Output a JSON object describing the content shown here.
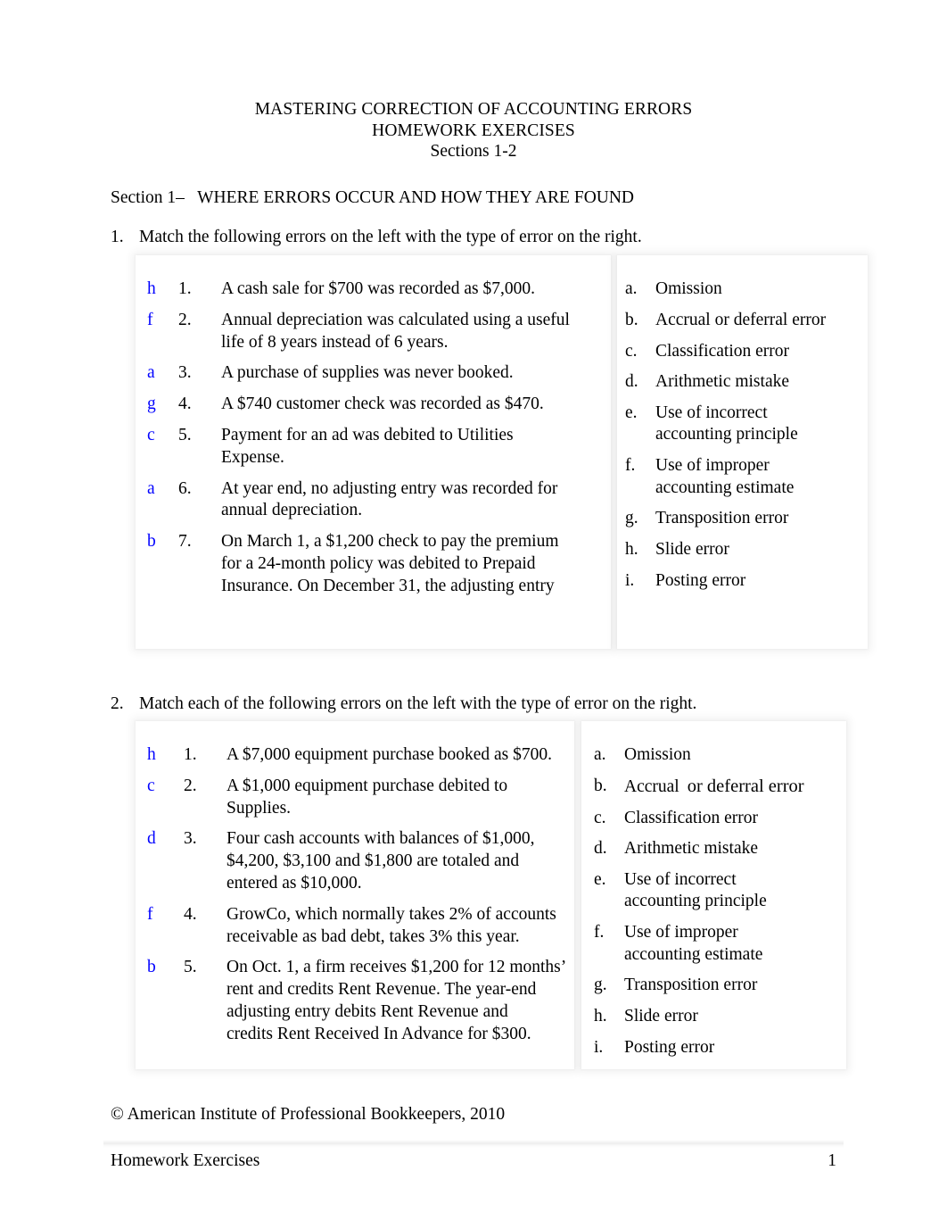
{
  "document": {
    "title_line_1": "MASTERING CORRECTION OF ACCOUNTING ERRORS",
    "title_line_2": "HOMEWORK EXERCISES",
    "title_line_3": "Sections 1-2",
    "section_heading": "Section 1–   WHERE ERRORS OCCUR AND HOW THEY ARE FOUND",
    "answer_color": "#0000ff"
  },
  "exercise_1": {
    "number": "1.",
    "prompt": "Match the following errors on the left with the type of error on the right.",
    "errors": [
      {
        "answer": "h",
        "num": "1.",
        "text": "A cash sale for $700 was recorded as $7,000."
      },
      {
        "answer": "f",
        "num": "2.",
        "text": "Annual depreciation was calculated using a useful\nlife of 8 years instead of 6 years."
      },
      {
        "answer": "a",
        "num": "3.",
        "text": "A purchase of supplies was never booked."
      },
      {
        "answer": "g",
        "num": "4.",
        "text": "A $740 customer check was recorded as $470."
      },
      {
        "answer": "c",
        "num": "5.",
        "text": "Payment for an ad was debited to Utilities\nExpense."
      },
      {
        "answer": "a",
        "num": "6.",
        "text": "At year end, no adjusting entry was recorded for\nannual depreciation."
      },
      {
        "answer": "b",
        "num": "7.",
        "text": "On March 1, a $1,200 check to pay the premium\nfor a 24-month policy was debited to Prepaid\nInsurance. On December 31, the adjusting entry"
      }
    ],
    "types": [
      {
        "letter": "a.",
        "label": "Omission"
      },
      {
        "letter": "b.",
        "label": "Accrual or deferral error"
      },
      {
        "letter": "c.",
        "label": "Classification error"
      },
      {
        "letter": "d.",
        "label": "Arithmetic mistake"
      },
      {
        "letter": "e.",
        "label": "Use of incorrect\naccounting principle"
      },
      {
        "letter": "f.",
        "label": "Use of improper\naccounting estimate"
      },
      {
        "letter": "g.",
        "label": "Transposition error"
      },
      {
        "letter": "h.",
        "label": "Slide error"
      },
      {
        "letter": "i.",
        "label": "Posting error"
      }
    ]
  },
  "exercise_2": {
    "number": "2.",
    "prompt": "Match each of the following errors on the left with the type of error on the right.",
    "errors": [
      {
        "answer": "h",
        "num": "1.",
        "text": "A $7,000 equipment purchase booked as $700."
      },
      {
        "answer": "c",
        "num": "2.",
        "text": "A $1,000 equipment purchase debited to\nSupplies."
      },
      {
        "answer": "d",
        "num": "3.",
        "text": "Four cash accounts with balances of $1,000,\n$4,200, $3,100 and $1,800 are totaled and\nentered as $10,000."
      },
      {
        "answer": "f",
        "num": "4.",
        "text": "GrowCo, which normally takes 2% of accounts\nreceivable as bad debt, takes 3% this year."
      },
      {
        "answer": "b",
        "num": "5.",
        "text": "On Oct. 1, a firm receives $1,200 for 12 months’\nrent and credits Rent Revenue. The year-end\nadjusting entry debits Rent Revenue and\ncredits Rent Received In Advance for $300."
      }
    ],
    "types": [
      {
        "letter": "a.",
        "label": "Omission"
      },
      {
        "letter": "b.",
        "label": "Accrual or deferral error",
        "split_a": "Accrual",
        "split_b": "or deferral error"
      },
      {
        "letter": "c.",
        "label": "Classification error"
      },
      {
        "letter": "d.",
        "label": "Arithmetic mistake"
      },
      {
        "letter": "e.",
        "label": "Use of incorrect\naccounting principle"
      },
      {
        "letter": "f.",
        "label": "Use of improper\naccounting estimate"
      },
      {
        "letter": "g.",
        "label": "Transposition error"
      },
      {
        "letter": "h.",
        "label": "Slide error"
      },
      {
        "letter": "i.",
        "label": "Posting error"
      }
    ]
  },
  "copyright": "© American Institute of Professional Bookkeepers, 2010",
  "footer": {
    "left": "Homework Exercises",
    "page_number": "1"
  }
}
